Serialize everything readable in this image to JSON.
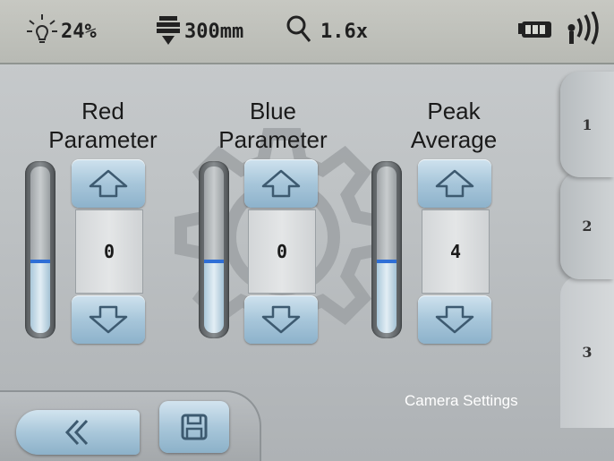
{
  "status_bar": {
    "light_icon": "light-bulb-icon",
    "light_level": "24%",
    "focus_icon": "focus-distance-icon",
    "focus_distance": "300mm",
    "zoom_icon": "magnifier-icon",
    "zoom": "1.6x",
    "battery_icon": "battery-icon",
    "signal_icon": "wireless-signal-icon"
  },
  "side_tabs": [
    {
      "label": "1"
    },
    {
      "label": "2"
    },
    {
      "label": "3",
      "selected": true
    }
  ],
  "parameters": [
    {
      "label": "Red\nParameter",
      "value": "0",
      "level_fraction": 0.43
    },
    {
      "label": "Blue\nParameter",
      "value": "0",
      "level_fraction": 0.43
    },
    {
      "label": "Peak\nAverage",
      "value": "4",
      "level_fraction": 0.43
    }
  ],
  "bottom_bar": {
    "back_icon": "double-chevron-left-icon",
    "save_icon": "save-disk-icon",
    "title": "Camera Settings"
  },
  "colors": {
    "accent_blue": "#2f6fd6",
    "button_blue": "#a9c7da",
    "background": "#bfc3c5"
  }
}
